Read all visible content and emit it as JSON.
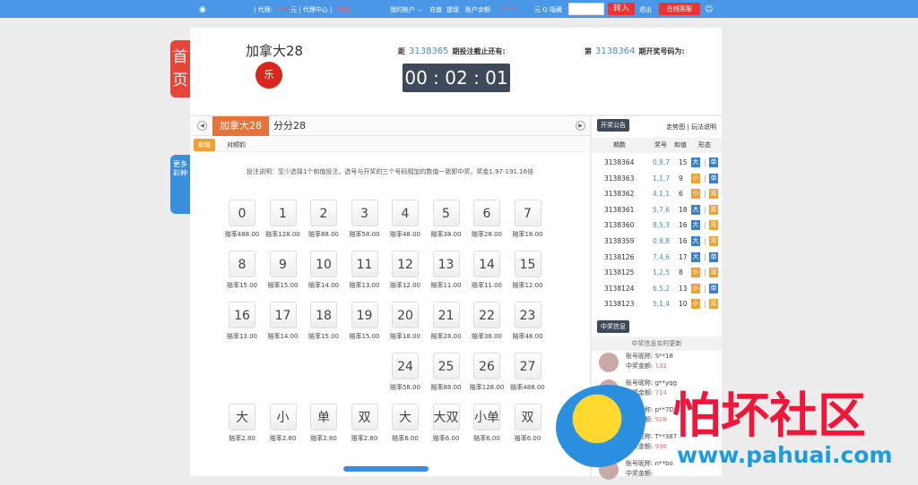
{
  "topbar": {
    "agent_label": "| 代理:",
    "agent_amount": "0.00",
    "agent_unit": "元 | 代理中心 |",
    "agent_extra": "充值",
    "account": "我的账户 ⌵",
    "recharge": "充值",
    "withdraw": "提现",
    "balance_label": "账户余额",
    "balance": "0.00",
    "balance_unit": "元 Q 隐藏",
    "transfer": "转入",
    "logout": "退出",
    "support": "在线客服"
  },
  "side": {
    "home": "首页",
    "more": "更多彩种"
  },
  "header": {
    "game_title": "加拿大28",
    "logo_text": "乐",
    "next_prefix": "距",
    "next_issue": "3138365",
    "next_suffix": "期投注截止还有:",
    "countdown": "00 : 02 : 01",
    "last_prefix": "第",
    "last_issue": "3138364",
    "last_suffix": "期开奖号码为:"
  },
  "tabs": [
    {
      "label": "加拿大28"
    },
    {
      "label": "分分28"
    }
  ],
  "subtabs": [
    {
      "label": "和值"
    },
    {
      "label": "对顺豹"
    }
  ],
  "description": "投注说明：至少选择1个和值投注，选号与开奖的三个号码相加的数值一致即中奖。奖金1.97-191.16倍",
  "bets": [
    {
      "n": "0",
      "o": "赔率488.00"
    },
    {
      "n": "1",
      "o": "赔率128.00"
    },
    {
      "n": "2",
      "o": "赔率88.00"
    },
    {
      "n": "3",
      "o": "赔率58.00"
    },
    {
      "n": "4",
      "o": "赔率48.00"
    },
    {
      "n": "5",
      "o": "赔率38.00"
    },
    {
      "n": "6",
      "o": "赔率28.00"
    },
    {
      "n": "7",
      "o": "赔率18.00"
    },
    {
      "n": "8",
      "o": "赔率15.00"
    },
    {
      "n": "9",
      "o": "赔率15.00"
    },
    {
      "n": "10",
      "o": "赔率14.00"
    },
    {
      "n": "11",
      "o": "赔率13.00"
    },
    {
      "n": "12",
      "o": "赔率12.00"
    },
    {
      "n": "13",
      "o": "赔率11.00"
    },
    {
      "n": "14",
      "o": "赔率11.00"
    },
    {
      "n": "15",
      "o": "赔率12.00"
    },
    {
      "n": "16",
      "o": "赔率13.00"
    },
    {
      "n": "17",
      "o": "赔率14.00"
    },
    {
      "n": "18",
      "o": "赔率15.00"
    },
    {
      "n": "19",
      "o": "赔率15.00"
    },
    {
      "n": "20",
      "o": "赔率18.00"
    },
    {
      "n": "21",
      "o": "赔率28.00"
    },
    {
      "n": "22",
      "o": "赔率38.00"
    },
    {
      "n": "23",
      "o": "赔率48.00"
    },
    {
      "n": "24",
      "o": "赔率58.00"
    },
    {
      "n": "25",
      "o": "赔率88.00"
    },
    {
      "n": "26",
      "o": "赔率128.00"
    },
    {
      "n": "27",
      "o": "赔率488.00"
    },
    {
      "n": "大",
      "o": "赔率2.80"
    },
    {
      "n": "小",
      "o": "赔率2.80"
    },
    {
      "n": "单",
      "o": "赔率2.80"
    },
    {
      "n": "双",
      "o": "赔率2.80"
    },
    {
      "n": "大",
      "o": "赔率6.00"
    },
    {
      "n": "大双",
      "o": "赔率6.00"
    },
    {
      "n": "小单",
      "o": "赔率6.00"
    },
    {
      "n": "双",
      "o": "赔率6.00"
    }
  ],
  "results": {
    "title": "开奖公告",
    "links": "走势图 | 玩法说明",
    "headers": [
      "期数",
      "奖号",
      "和值",
      "形态"
    ],
    "rows": [
      {
        "issue": "3138364",
        "nums": "0,8,7",
        "sum": "15",
        "size": "大",
        "parity": "单"
      },
      {
        "issue": "3138363",
        "nums": "1,1,7",
        "sum": "9",
        "size": "小",
        "parity": "单"
      },
      {
        "issue": "3138362",
        "nums": "4,1,1",
        "sum": "6",
        "size": "小",
        "parity": "双"
      },
      {
        "issue": "3138361",
        "nums": "5,7,6",
        "sum": "18",
        "size": "大",
        "parity": "双"
      },
      {
        "issue": "3138360",
        "nums": "8,5,3",
        "sum": "16",
        "size": "大",
        "parity": "双"
      },
      {
        "issue": "3138359",
        "nums": "0,8,8",
        "sum": "16",
        "size": "大",
        "parity": "双"
      },
      {
        "issue": "3138126",
        "nums": "7,4,6",
        "sum": "17",
        "size": "大",
        "parity": "单"
      },
      {
        "issue": "3138125",
        "nums": "1,2,5",
        "sum": "8",
        "size": "小",
        "parity": "双"
      },
      {
        "issue": "3138124",
        "nums": "6,5,2",
        "sum": "13",
        "size": "小",
        "parity": "单"
      },
      {
        "issue": "3138123",
        "nums": "5,1,4",
        "sum": "10",
        "size": "小",
        "parity": "双"
      }
    ]
  },
  "winners": {
    "title": "中奖信息",
    "live": "中奖信息实时更新",
    "name_label": "账号昵称:",
    "amount_label": "中奖金额:",
    "items": [
      {
        "name": "S**18",
        "amount": "132"
      },
      {
        "name": "g**yqg",
        "amount": "714"
      },
      {
        "name": "p**7DI",
        "amount": "928"
      },
      {
        "name": "T**387",
        "amount": "936"
      },
      {
        "name": "n**bo",
        "amount": ""
      }
    ]
  },
  "watermark": {
    "title": "怕坏社区",
    "url": "www.pahuai.com"
  }
}
